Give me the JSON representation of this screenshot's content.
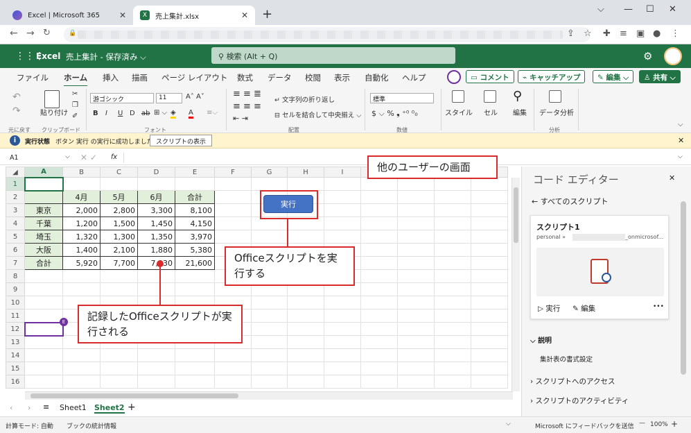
{
  "browser": {
    "tabs": [
      {
        "label": "Excel | Microsoft 365"
      },
      {
        "label": "売上集計.xlsx"
      }
    ]
  },
  "excel": {
    "app": "Excel",
    "doc_title": "売上集計 - 保存済み ⌵",
    "search_placeholder": "検索 (Alt + Q)"
  },
  "ribbon": {
    "tabs": [
      "ファイル",
      "ホーム",
      "挿入",
      "描画",
      "ページ レイアウト",
      "数式",
      "データ",
      "校閲",
      "表示",
      "自動化",
      "ヘルプ"
    ],
    "comment": "コメント",
    "catchup": "キャッチアップ",
    "edit": "編集 ⌵",
    "share": "共有 ⌵",
    "clipboard": {
      "paste": "貼り付け",
      "label": "クリップボード",
      "undo_label": "元に戻す"
    },
    "font": {
      "name": "游ゴシック",
      "size": "11",
      "label": "フォント"
    },
    "align": {
      "wrap": "文字列の折り返し",
      "merge": "セルを結合して中央揃え ⌵",
      "label": "配置"
    },
    "number": {
      "format": "標準",
      "label": "数値"
    },
    "styles": "スタイル",
    "cells": "セル",
    "editing": "編集",
    "analyze": "データ分析",
    "analysis_label": "分析"
  },
  "infobar": {
    "bold": "実行状態",
    "text": "ボタン 実行 の実行に成功しました。",
    "button": "スクリプトの表示"
  },
  "formula": {
    "cellref": "A1",
    "fx": "fx"
  },
  "sheet": {
    "columns": [
      "A",
      "B",
      "C",
      "D",
      "E",
      "F",
      "G",
      "H",
      "I"
    ],
    "rows": [
      "1",
      "2",
      "3",
      "4",
      "5",
      "6",
      "7",
      "8",
      "9",
      "10",
      "11",
      "12",
      "13",
      "14",
      "15",
      "16"
    ],
    "header": [
      "",
      "4月",
      "5月",
      "6月",
      "合計"
    ],
    "data": [
      [
        "東京",
        "2,000",
        "2,800",
        "3,300",
        "8,100"
      ],
      [
        "千葉",
        "1,200",
        "1,500",
        "1,450",
        "4,150"
      ],
      [
        "埼玉",
        "1,320",
        "1,300",
        "1,350",
        "3,970"
      ],
      [
        "大阪",
        "1,400",
        "2,100",
        "1,880",
        "5,380"
      ],
      [
        "合計",
        "5,920",
        "7,700",
        "7,930",
        "21,600"
      ]
    ],
    "run_button": "実行",
    "tabs": [
      "Sheet1",
      "Sheet2"
    ],
    "collab_badge": "E"
  },
  "status": {
    "mode": "計算モード: 自動",
    "stats": "ブックの統計情報",
    "feedback": "Microsoft にフィードバックを送信",
    "zoom": "100%"
  },
  "pane": {
    "title": "コード エディター",
    "back": "すべてのスクリプト",
    "script_name": "スクリプト1",
    "owner_prefix": "personal »",
    "owner_suffix": "_onmicrosof...",
    "run": "実行",
    "edit": "編集",
    "more": "•••",
    "desc_header": "説明",
    "desc_text": "集計表の書式設定",
    "access": "スクリプトへのアクセス",
    "activity": "スクリプトのアクティビティ"
  },
  "annotations": {
    "other_user": "他のユーザーの画面",
    "run_script": "Officeスクリプトを実行する",
    "recorded": "記録したOfficeスクリプトが実行される"
  }
}
